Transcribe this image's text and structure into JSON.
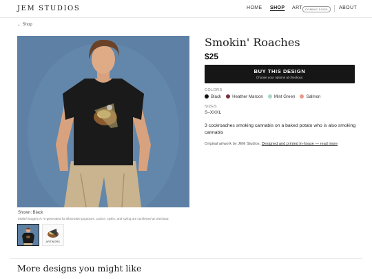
{
  "header": {
    "brand": "JEM STUDIOS",
    "nav": {
      "home": "HOME",
      "shop": "SHOP",
      "art": "ART",
      "coming_soon": "COMING SOON",
      "about": "ABOUT"
    }
  },
  "breadcrumb": {
    "back": "← Shop"
  },
  "gallery": {
    "caption": "Shown: Black",
    "disclaimer": "Model imagery is AI-generated for illustrative purposes. Colors, styles, and sizing are confirmed at checkout.",
    "thumbnails": [
      {
        "selected": true
      },
      {
        "label": "ARTWORK"
      }
    ]
  },
  "product": {
    "title": "Smokin' Roaches",
    "price": "$25",
    "buy_label": "BUY THIS DESIGN",
    "buy_sub": "Choose your options at checkout.",
    "colors_label": "COLORS",
    "colors": [
      {
        "name": "Black",
        "hex": "#111111"
      },
      {
        "name": "Heather Maroon",
        "hex": "#7a2e3a"
      },
      {
        "name": "Mint Green",
        "hex": "#a9d8c2"
      },
      {
        "name": "Salmon",
        "hex": "#e89a8a"
      }
    ],
    "sizes_label": "SIZES",
    "sizes": "S–XXXL",
    "description": "3 cockroaches smoking cannabis on a baked potato who is also smoking cannabis",
    "credit_prefix": "Original artwork by JEM Studios.",
    "credit_link": "Designed and printed in-house — read more"
  },
  "more": {
    "heading": "More designs you might like"
  },
  "colors": {
    "accent": "#161616",
    "photo_bg": "#5d80a4",
    "shirt": "#1a1a1a"
  }
}
